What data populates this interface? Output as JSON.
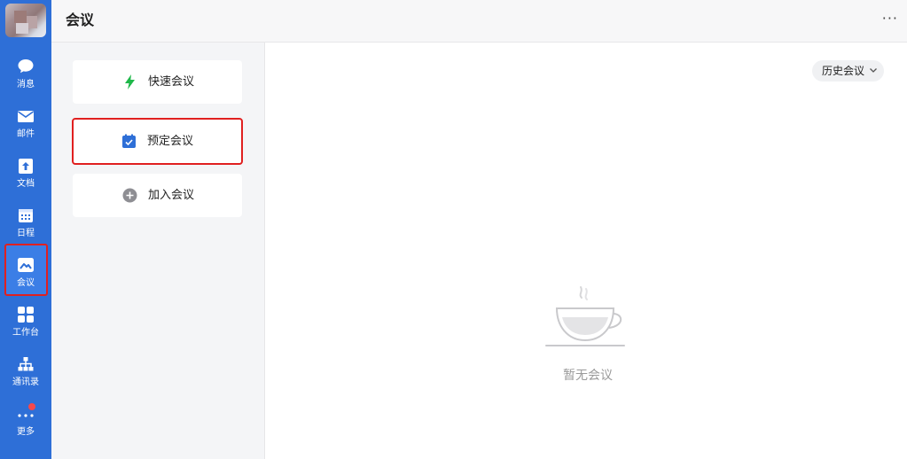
{
  "app": {
    "title": "会议"
  },
  "nav": {
    "items": [
      {
        "key": "messages",
        "label": "消息",
        "icon": "chat-bubble-icon"
      },
      {
        "key": "mail",
        "label": "邮件",
        "icon": "mail-icon"
      },
      {
        "key": "docs",
        "label": "文档",
        "icon": "document-icon"
      },
      {
        "key": "calendar",
        "label": "日程",
        "icon": "calendar-icon"
      },
      {
        "key": "meeting",
        "label": "会议",
        "icon": "meeting-icon",
        "active": true
      },
      {
        "key": "workbench",
        "label": "工作台",
        "icon": "apps-grid-icon"
      },
      {
        "key": "contacts",
        "label": "通讯录",
        "icon": "org-chart-icon"
      },
      {
        "key": "more",
        "label": "更多",
        "icon": "more-dots-icon",
        "badge": true
      }
    ]
  },
  "header": {
    "more": "···"
  },
  "actions": [
    {
      "key": "quick",
      "label": "快速会议",
      "icon": "lightning-icon",
      "color": "#1fb84a"
    },
    {
      "key": "schedule",
      "label": "预定会议",
      "icon": "calendar-check-icon",
      "color": "#2e6fd7",
      "selected": true
    },
    {
      "key": "join",
      "label": "加入会议",
      "icon": "plus-circle-icon",
      "color": "#8e8e93"
    }
  ],
  "history": {
    "label": "历史会议"
  },
  "empty": {
    "text": "暂无会议"
  },
  "colors": {
    "rail": "#2e6fd7",
    "highlight": "#e02020",
    "accent_green": "#1fb84a"
  }
}
